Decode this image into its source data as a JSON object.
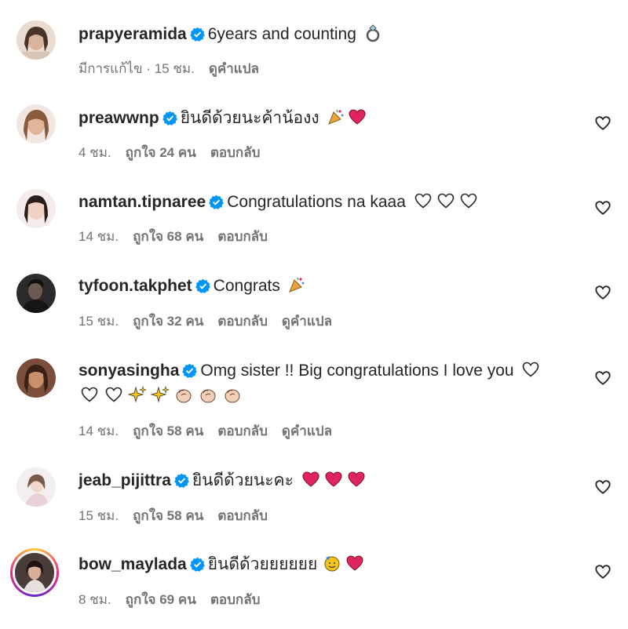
{
  "comments": [
    {
      "username": "prapyeramida",
      "text": "6years and counting",
      "emoji": [
        "ring"
      ],
      "meta": [
        "มีการแก้ไข · 15 ชม.",
        "ดูคำแปล"
      ],
      "has_like": false,
      "avatar_color": "#c9a28c"
    },
    {
      "username": "preawwnp",
      "text": "ยินดีด้วยนะค้าน้องง",
      "emoji": [
        "party-popper",
        "heart-red"
      ],
      "meta": [
        "4 ชม.",
        "ถูกใจ 24 คน",
        "ตอบกลับ"
      ],
      "has_like": true,
      "avatar_color": "#d8a98b"
    },
    {
      "username": "namtan.tipnaree",
      "text": "Congratulations na kaaa",
      "emoji": [
        "heart-outline",
        "heart-outline",
        "heart-outline"
      ],
      "meta": [
        "14 ชม.",
        "ถูกใจ 68 คน",
        "ตอบกลับ"
      ],
      "has_like": true,
      "avatar_color": "#e2c6b8"
    },
    {
      "username": "tyfoon.takphet",
      "text": "Congrats",
      "emoji": [
        "party-popper"
      ],
      "meta": [
        "15 ชม.",
        "ถูกใจ 32 คน",
        "ตอบกลับ",
        "ดูคำแปล"
      ],
      "has_like": true,
      "avatar_color": "#3b3b3b"
    },
    {
      "username": "sonyasingha",
      "text": "Omg sister !! Big congratulations I love you",
      "emoji": [
        "heart-outline",
        "heart-outline",
        "heart-outline",
        "sparkles",
        "sparkles",
        "clap",
        "clap",
        "clap"
      ],
      "meta": [
        "14 ชม.",
        "ถูกใจ 58 คน",
        "ตอบกลับ",
        "ดูคำแปล"
      ],
      "has_like": true,
      "avatar_color": "#b07b5e"
    },
    {
      "username": "jeab_pijittra",
      "text": "ยินดีด้วยนะคะ",
      "emoji": [
        "heart-red",
        "heart-red",
        "heart-red"
      ],
      "meta": [
        "15 ชม.",
        "ถูกใจ 58 คน",
        "ตอบกลับ"
      ],
      "has_like": true,
      "avatar_color": "#e9dde0"
    },
    {
      "username": "bow_maylada",
      "text": "ยินดีด้วยยยยยย",
      "emoji": [
        "partying-face",
        "heart-red"
      ],
      "meta": [
        "8 ชม.",
        "ถูกใจ 69 คน",
        "ตอบกลับ"
      ],
      "has_like": true,
      "avatar_color": "#5a4a46",
      "story_ring": true
    }
  ],
  "colors": {
    "verified": "#0095f6",
    "meta_text": "#737373",
    "primary_text": "#262626",
    "heart_red": "#e0245e"
  }
}
